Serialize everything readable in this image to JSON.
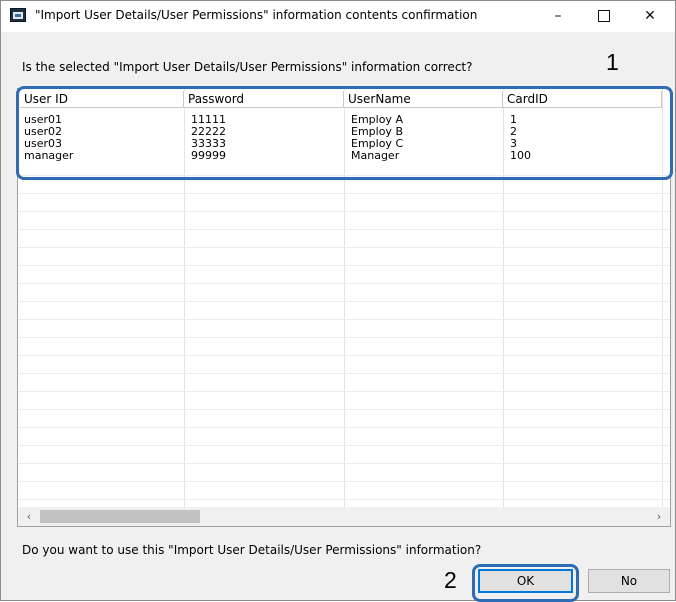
{
  "window": {
    "title": "\"Import User Details/User Permissions\" information contents confirmation",
    "minimize_glyph": "–",
    "close_glyph": "✕"
  },
  "prompt": "Is the selected \"Import User Details/User Permissions\" information correct?",
  "annotations": [
    "1",
    "2"
  ],
  "table": {
    "columns": [
      "User ID",
      "Password",
      "UserName",
      "CardID"
    ],
    "rows": [
      [
        "user01",
        "11111",
        "Employ A",
        "1"
      ],
      [
        "user02",
        "22222",
        "Employ B",
        "2"
      ],
      [
        "user03",
        "33333",
        "Employ C",
        "3"
      ],
      [
        "manager",
        "99999",
        "Manager",
        "100"
      ]
    ]
  },
  "scrollbar": {
    "left_glyph": "‹",
    "right_glyph": "›"
  },
  "question": "Do you want to use this \"Import User Details/User Permissions\" information?",
  "buttons": {
    "ok": "OK",
    "no": "No"
  },
  "colors": {
    "annotation_outline": "#2e6cb5",
    "default_button_border": "#0078d7"
  }
}
